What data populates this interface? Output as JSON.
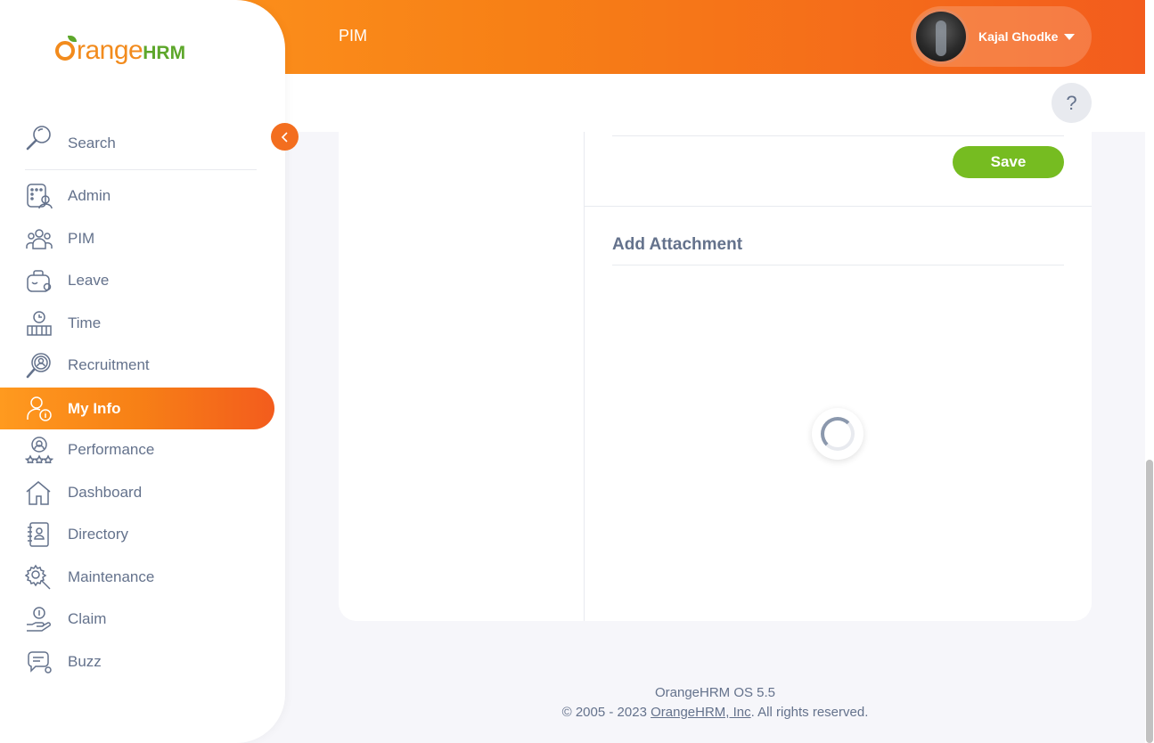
{
  "header": {
    "title": "PIM",
    "user_name": "Kajal Ghodke",
    "help_label": "?"
  },
  "sidebar": {
    "logo_text_main": "range",
    "logo_text_hrm": "HRM",
    "search_placeholder": "Search",
    "items": [
      {
        "label": "Admin",
        "icon": "admin-icon"
      },
      {
        "label": "PIM",
        "icon": "pim-icon"
      },
      {
        "label": "Leave",
        "icon": "leave-icon"
      },
      {
        "label": "Time",
        "icon": "time-icon"
      },
      {
        "label": "Recruitment",
        "icon": "recruitment-icon"
      },
      {
        "label": "My Info",
        "icon": "my-info-icon",
        "active": true
      },
      {
        "label": "Performance",
        "icon": "performance-icon"
      },
      {
        "label": "Dashboard",
        "icon": "dashboard-icon"
      },
      {
        "label": "Directory",
        "icon": "directory-icon"
      },
      {
        "label": "Maintenance",
        "icon": "maintenance-icon"
      },
      {
        "label": "Claim",
        "icon": "claim-icon"
      },
      {
        "label": "Buzz",
        "icon": "buzz-icon"
      }
    ]
  },
  "main": {
    "save_label": "Save",
    "attachment_title": "Add Attachment"
  },
  "footer": {
    "version": "OrangeHRM OS 5.5",
    "copyright_prefix": "© 2005 - 2023 ",
    "company_link": "OrangeHRM, Inc",
    "copyright_suffix": ". All rights reserved."
  },
  "colors": {
    "brand_orange": "#f78016",
    "save_green": "#76bc21",
    "text_gray": "#64728c"
  }
}
